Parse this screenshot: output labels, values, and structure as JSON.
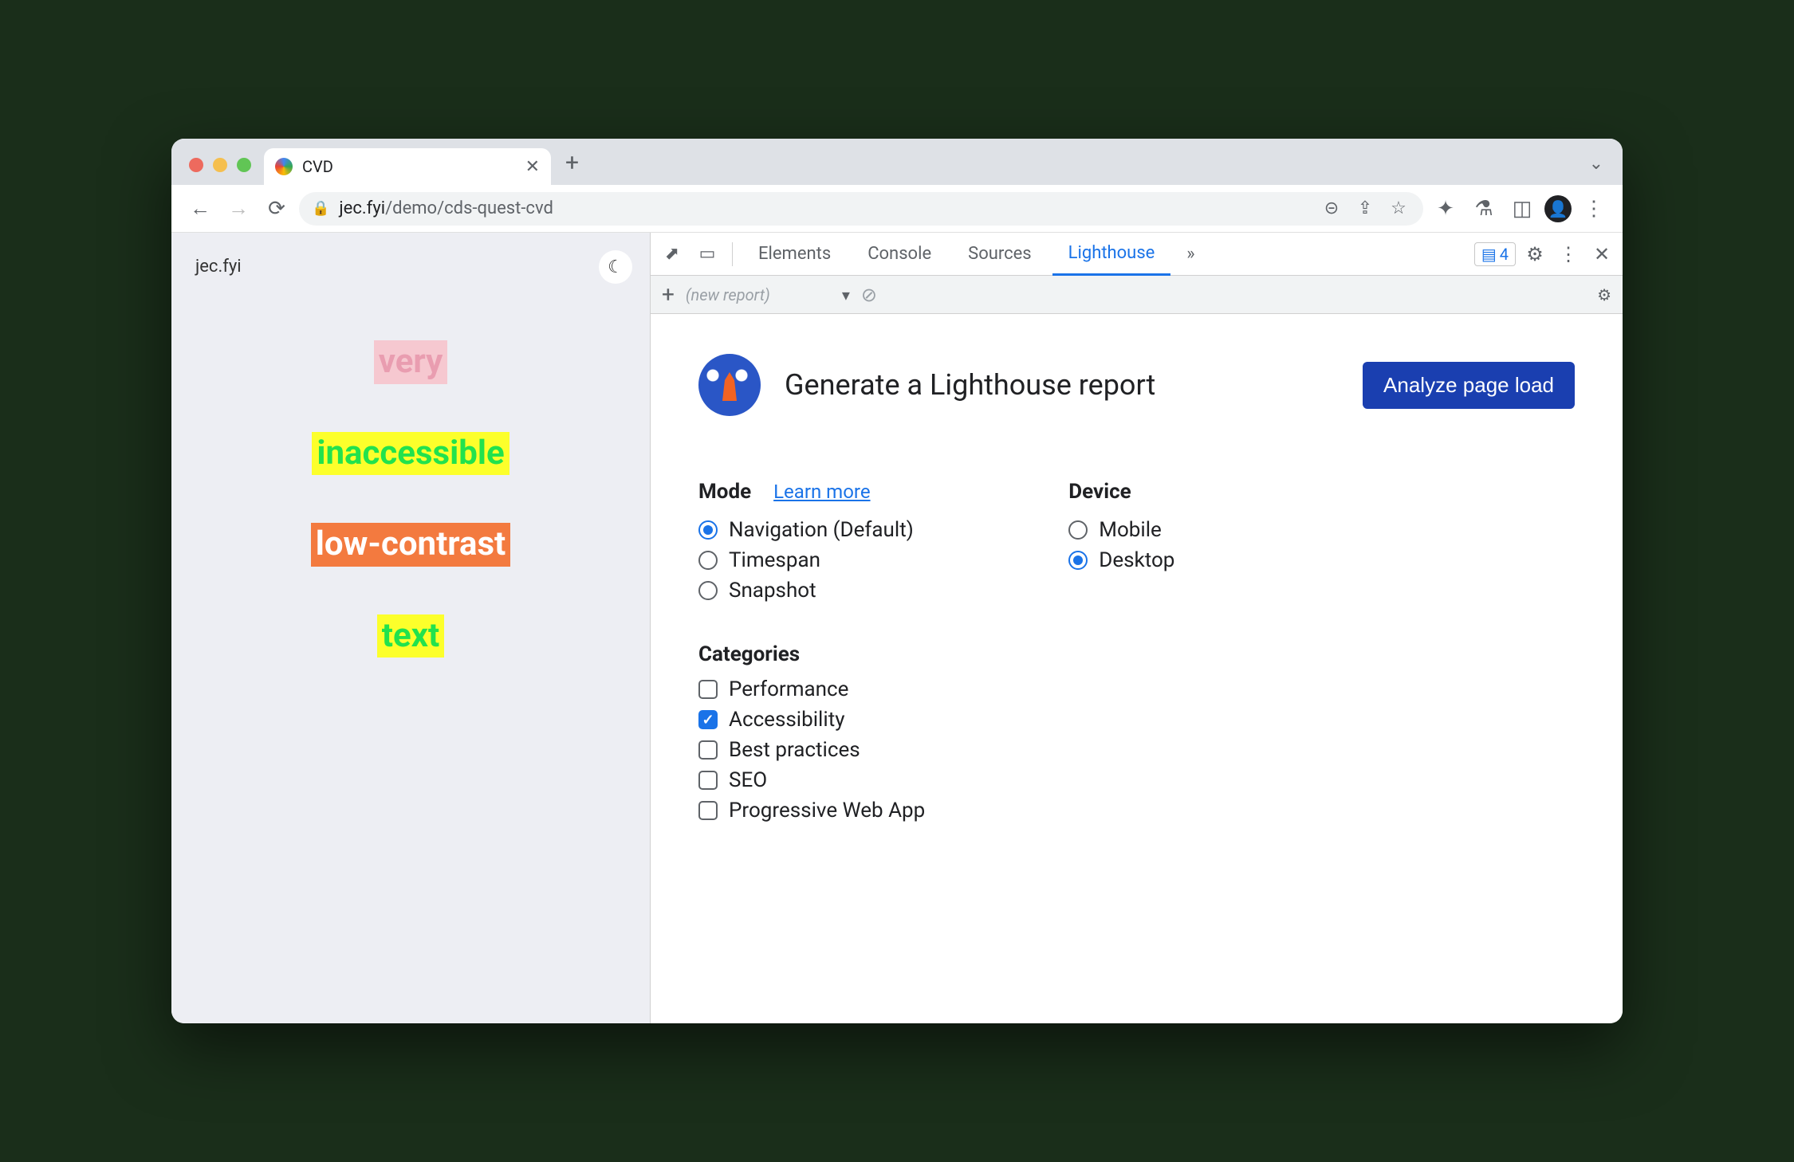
{
  "browser": {
    "tab_title": "CVD",
    "url_host": "jec.fyi",
    "url_path": "/demo/cds-quest-cvd"
  },
  "page": {
    "brand": "jec.fyi",
    "samples": [
      "very",
      "inaccessible",
      "low-contrast",
      "text"
    ]
  },
  "devtools": {
    "tabs": [
      "Elements",
      "Console",
      "Sources",
      "Lighthouse"
    ],
    "active_tab": "Lighthouse",
    "issues_count": "4",
    "subbar_label": "(new report)"
  },
  "lighthouse": {
    "heading": "Generate a Lighthouse report",
    "analyze_button": "Analyze page load",
    "mode_label": "Mode",
    "learn_more": "Learn more",
    "modes": [
      {
        "label": "Navigation (Default)",
        "selected": true
      },
      {
        "label": "Timespan",
        "selected": false
      },
      {
        "label": "Snapshot",
        "selected": false
      }
    ],
    "device_label": "Device",
    "devices": [
      {
        "label": "Mobile",
        "selected": false
      },
      {
        "label": "Desktop",
        "selected": true
      }
    ],
    "categories_label": "Categories",
    "categories": [
      {
        "label": "Performance",
        "selected": false
      },
      {
        "label": "Accessibility",
        "selected": true
      },
      {
        "label": "Best practices",
        "selected": false
      },
      {
        "label": "SEO",
        "selected": false
      },
      {
        "label": "Progressive Web App",
        "selected": false
      }
    ]
  }
}
